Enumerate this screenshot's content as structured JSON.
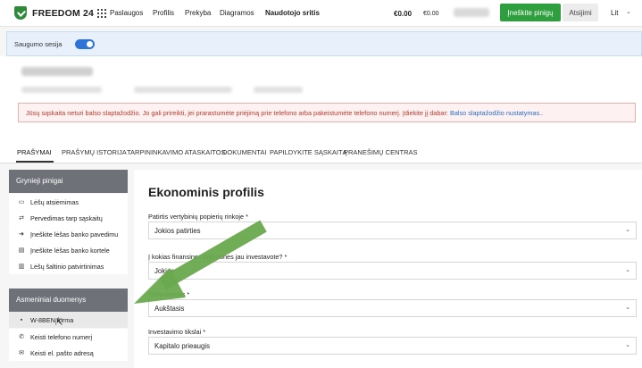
{
  "brand": {
    "name": "FREEDOM 24",
    "color": "#2f8a3c"
  },
  "nav": {
    "items": [
      "Paslaugos",
      "Profilis",
      "Prekyba",
      "Diagramos",
      "Naudotojo sritis"
    ],
    "active_index": 4
  },
  "balances": {
    "primary": "€0.00",
    "secondary": "€0.00"
  },
  "actions": {
    "deposit": "Įneškite pinigų",
    "logout": "Atsijimi",
    "language": "Lit"
  },
  "session": {
    "label": "Saugumo sesija",
    "enabled": true
  },
  "warning": {
    "text": "Jūsų sąskaita neturi balso slaptažodžio. Jo gali prireikti, jei prarastumėte priėjimą prie telefono arba pakeistumėte telefono numerį. Įdiekite jį dabar: ",
    "link": "Balso slaptažodžio nustatymas.."
  },
  "tabs": [
    "PRAŠYMAI",
    "PRAŠYMŲ ISTORIJA",
    "TARPININKAVIMO ATASKAITOS",
    "DOKUMENTAI",
    "PAPILDYKITE SĄSKAITĄ",
    "PRANEŠIMŲ CENTRAS"
  ],
  "sidebar": {
    "section1": {
      "title": "Grynieji pinigai",
      "items": [
        {
          "icon": "wallet-icon",
          "glyph": "▭",
          "label": "Lėšų atsiėmimas"
        },
        {
          "icon": "transfer-icon",
          "glyph": "⇄",
          "label": "Pervedimas tarp sąskaitų"
        },
        {
          "icon": "bank-transfer-icon",
          "glyph": "➜",
          "label": "Įneškite lėšas banko pavedimu"
        },
        {
          "icon": "card-icon",
          "glyph": "▤",
          "label": "Įneškite lėšas banko kortele"
        },
        {
          "icon": "document-icon",
          "glyph": "▥",
          "label": "Lėšų šaltinio patvirtinimas"
        }
      ]
    },
    "section2": {
      "title": "Asmeniniai duomenys",
      "items": [
        {
          "icon": "file-icon",
          "glyph": "▪",
          "label": "W-8BEN forma"
        },
        {
          "icon": "phone-icon",
          "glyph": "✆",
          "label": "Keisti telefono numerį"
        },
        {
          "icon": "email-icon",
          "glyph": "✉",
          "label": "Keisti el. pašto adresą"
        }
      ]
    }
  },
  "form": {
    "title": "Ekonominis profilis",
    "fields": [
      {
        "label": "Patirtis vertybinių popierių rinkoje *",
        "value": "Jokios patirties"
      },
      {
        "label": "Į kokias finansines priemones jau investavote? *",
        "value": "Jokias"
      },
      {
        "label": "Išsilavinimas *",
        "value": "Aukštasis"
      },
      {
        "label": "Investavimo tikslai *",
        "value": "Kapitalo prieaugis"
      }
    ]
  }
}
